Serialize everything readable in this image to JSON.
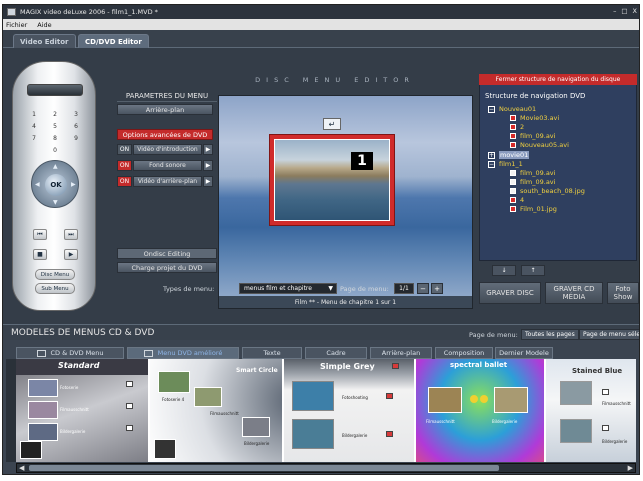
{
  "window": {
    "title": "MAGIX video deLuxe 2006 - film1_1.MVD *",
    "min": "–",
    "max": "□",
    "close": "X"
  },
  "menubar": [
    "Fichier",
    "Aide"
  ],
  "top_tabs": [
    "Video Editor",
    "CD/DVD Editor"
  ],
  "remote": {
    "numbers": [
      "1",
      "2",
      "3",
      "4",
      "5",
      "6",
      "7",
      "8",
      "9",
      "0"
    ],
    "ok": "OK",
    "disc_menu": "Disc Menu",
    "sub_menu": "Sub Menu"
  },
  "params": {
    "title": "PARAMETRES DU MENU",
    "arriere_plan": "Arrière-plan",
    "options_avancees": "Options avancées de DVD",
    "rows": [
      {
        "toggle": "ON",
        "label": "Vidéo d'introduction",
        "active": false
      },
      {
        "toggle": "ON",
        "label": "Fond sonore",
        "active": true
      },
      {
        "toggle": "ON",
        "label": "Vidéo d'arrière-plan",
        "active": true
      }
    ],
    "ondisc": "Ondisc Editing",
    "charge": "Charge projet du DVD"
  },
  "editor_title": "DISC MENU EDITOR",
  "preview": {
    "chapter_number": "1",
    "caption": "Film ** - Menu de chapitre 1 sur 1",
    "enter_icon": "↵"
  },
  "menu_types": {
    "label": "Types de menu:",
    "value": "menus film et chapitre"
  },
  "page_menu": {
    "label": "Page de menu:",
    "value": "1/1",
    "minus": "−",
    "plus": "+"
  },
  "nav": {
    "close": "Fermer structure de navigation du disque",
    "title": "Structure de navigation DVD",
    "tree": [
      {
        "label": "Nouveau01",
        "level": 0,
        "kind": "folder"
      },
      {
        "label": "Movie03.avi",
        "level": 1,
        "kind": "red"
      },
      {
        "label": "2",
        "level": 1,
        "kind": "red"
      },
      {
        "label": "film_09.avi",
        "level": 1,
        "kind": "red"
      },
      {
        "label": "Nouveau05.avi",
        "level": 1,
        "kind": "red"
      },
      {
        "label": "movie01",
        "level": 0,
        "kind": "plus"
      },
      {
        "label": "film1_1",
        "level": 0,
        "kind": "folder"
      },
      {
        "label": "film_09.avi",
        "level": 1,
        "kind": "white"
      },
      {
        "label": "film_09.avi",
        "level": 1,
        "kind": "white"
      },
      {
        "label": "south_beach_08.jpg",
        "level": 1,
        "kind": "white"
      },
      {
        "label": "4",
        "level": 1,
        "kind": "red"
      },
      {
        "label": "Film_01.jpg",
        "level": 1,
        "kind": "red"
      }
    ],
    "down": "↓",
    "up": "↑"
  },
  "burn": {
    "graver_disc": "GRAVER DISC",
    "graver_media": "GRAVER CD MÉDIA",
    "foto_show": "Foto Show"
  },
  "bottom": {
    "title": "MODELES DE MENUS CD & DVD",
    "page_menu_label": "Page de menu:",
    "toutes_pages": "Toutes les pages",
    "page_selectionnee": "Page de menu sélectionnée",
    "tabs": [
      "CD & DVD Menu",
      "Menu DVD amélioré",
      "Texte",
      "Cadre",
      "Arrière-plan",
      "Composition",
      "Dernier Modele"
    ],
    "templates": [
      {
        "name": "Standard",
        "labels": [
          "Fotoserie",
          "Filmausschnitt",
          "Bildergalerie"
        ]
      },
      {
        "name": "Smart Circle",
        "labels": [
          "Fotoserie 4",
          "Filmausschnitt",
          "Bildergalerie"
        ]
      },
      {
        "name": "Simple Grey",
        "labels": [
          "Fotoshooting",
          "Bildergalerie"
        ]
      },
      {
        "name": "spectral ballet",
        "labels": [
          "Filmausschnitt",
          "Bildergalerie"
        ]
      },
      {
        "name": "Stained Blue",
        "labels": [
          "Filmausschnitt",
          "Bildergalerie"
        ]
      }
    ]
  },
  "colors": {
    "accent_red": "#c42b2b",
    "panel": "#343d48",
    "nav_bg": "#2f3f5f",
    "tree_text": "#f0d040"
  }
}
